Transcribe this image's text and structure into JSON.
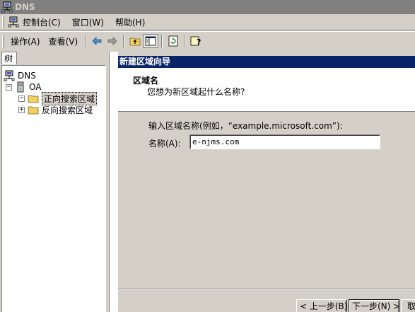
{
  "window": {
    "title": "DNS",
    "icon": "dns-server-icon"
  },
  "menubar": {
    "items": [
      {
        "label": "控制台(C)",
        "icon": "console-icon"
      },
      {
        "label": "窗口(W)"
      },
      {
        "label": "帮助(H)"
      }
    ]
  },
  "toolbar": {
    "action_label": "操作(A)",
    "view_label": "查看(V)",
    "icons": [
      "back-arrow-icon",
      "forward-arrow-icon",
      "up-folder-icon",
      "show-hide-tree-icon",
      "refresh-icon",
      "help-icon"
    ]
  },
  "tree": {
    "tab_label": "树",
    "items": [
      {
        "label": "DNS",
        "icon": "dns-icon",
        "level": 0
      },
      {
        "label": "OA",
        "icon": "server-icon",
        "level": 1,
        "expander": "−"
      },
      {
        "label": "正向搜索区域",
        "icon": "folder-icon",
        "level": 2,
        "expander": "−",
        "selected": true
      },
      {
        "label": "反向搜索区域",
        "icon": "folder-icon",
        "level": 2,
        "expander": "+"
      }
    ]
  },
  "wizard": {
    "title": "新建区域向导",
    "header_title": "区域名",
    "header_subtitle": "您想为新区域起什么名称?",
    "prompt": "输入区域名称(例如，“example.microsoft.com”):",
    "name_label": "名称(A):",
    "name_value": "e-njms.com",
    "back_label": "< 上一步(B)",
    "next_label": "下一步(N) >",
    "cancel_label": "取"
  },
  "colors": {
    "titlebar_bg": "#808080",
    "wizard_title_bg": "#0a246a",
    "face": "#d4d0c8"
  }
}
